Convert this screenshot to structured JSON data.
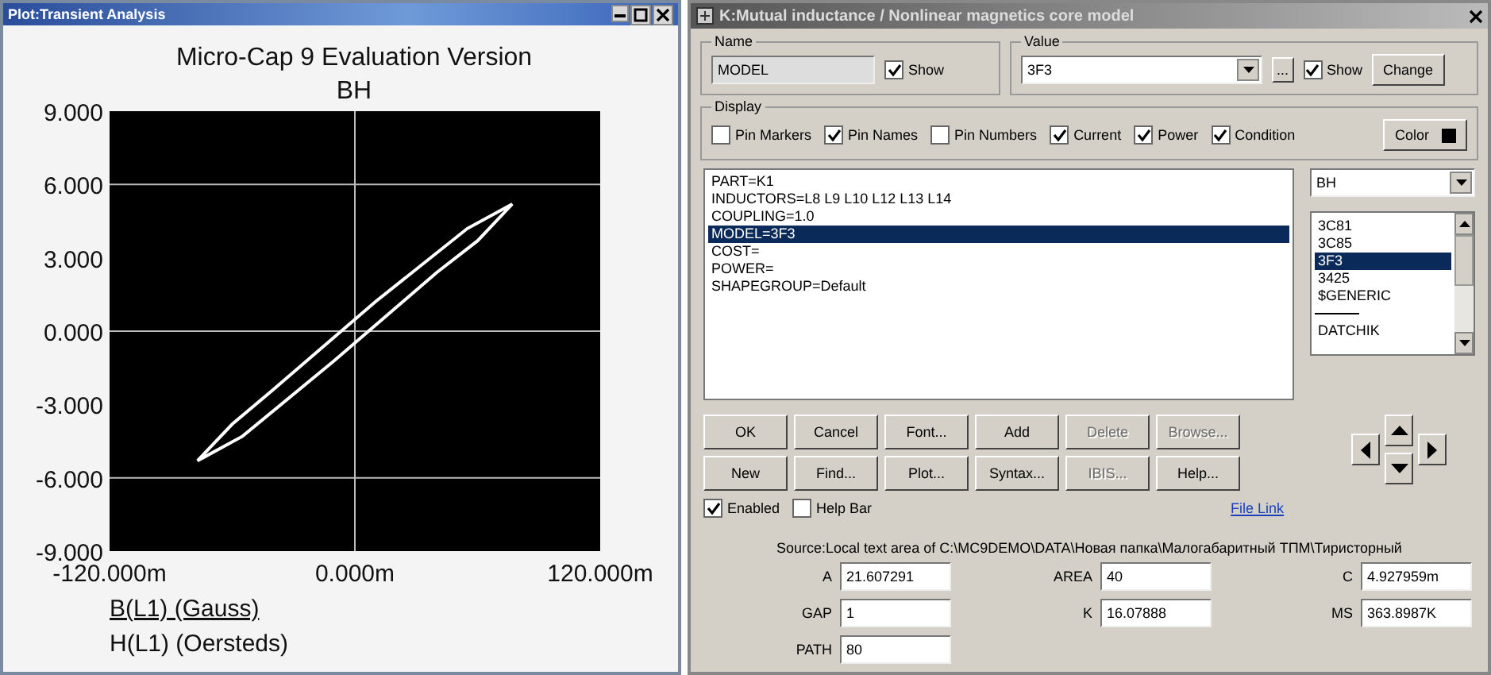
{
  "plot_window": {
    "title": "Plot:Transient Analysis",
    "heading": "Micro-Cap 9 Evaluation Version",
    "curve_label": "B(L1) (Gauss)",
    "chart_data": {
      "type": "line",
      "title": "BH",
      "xlabel": "H(L1) (Oersteds)",
      "grid": true,
      "xlim": [
        -120,
        120
      ],
      "ylim": [
        -9,
        9
      ],
      "xticks": [
        {
          "value": -120,
          "label": "-120.000m"
        },
        {
          "value": 0,
          "label": "0.000m"
        },
        {
          "value": 120,
          "label": "120.000m"
        }
      ],
      "yticks": [
        {
          "value": 9,
          "label": "9.000"
        },
        {
          "value": 6,
          "label": "6.000"
        },
        {
          "value": 3,
          "label": "3.000"
        },
        {
          "value": 0,
          "label": "0.000"
        },
        {
          "value": -3,
          "label": "-3.000"
        },
        {
          "value": -6,
          "label": "-6.000"
        },
        {
          "value": -9,
          "label": "-9.000"
        }
      ]
    }
  },
  "dialog": {
    "title": "K:Mutual inductance / Nonlinear magnetics core model",
    "name_group": {
      "label": "Name",
      "value": "MODEL",
      "show_label": "Show",
      "show_checked": true
    },
    "value_group": {
      "label": "Value",
      "value": "3F3",
      "more_button": "...",
      "show_label": "Show",
      "show_checked": true,
      "change_button": "Change"
    },
    "display_group": {
      "label": "Display",
      "options": [
        {
          "label": "Pin Markers",
          "checked": false
        },
        {
          "label": "Pin Names",
          "checked": true
        },
        {
          "label": "Pin Numbers",
          "checked": false
        },
        {
          "label": "Current",
          "checked": true
        },
        {
          "label": "Power",
          "checked": true
        },
        {
          "label": "Condition",
          "checked": true
        }
      ],
      "color_button": "Color"
    },
    "attributes": [
      {
        "text": "PART=K1",
        "selected": false
      },
      {
        "text": "INDUCTORS=L8 L9 L10 L12 L13 L14",
        "selected": false
      },
      {
        "text": "COUPLING=1.0",
        "selected": false
      },
      {
        "text": "MODEL=3F3",
        "selected": true
      },
      {
        "text": "COST=",
        "selected": false
      },
      {
        "text": "POWER=",
        "selected": false
      },
      {
        "text": "SHAPEGROUP=Default",
        "selected": false
      }
    ],
    "model_combo": "BH",
    "models": [
      {
        "text": "3C81",
        "selected": false,
        "kind": "item"
      },
      {
        "text": "3C85",
        "selected": false,
        "kind": "item"
      },
      {
        "text": "3F3",
        "selected": true,
        "kind": "item"
      },
      {
        "text": "3425",
        "selected": false,
        "kind": "item"
      },
      {
        "text": "$GENERIC",
        "selected": false,
        "kind": "item"
      },
      {
        "kind": "separator",
        "selected": false
      },
      {
        "text": "DATCHIK",
        "selected": false,
        "kind": "item"
      }
    ],
    "button_rows": [
      [
        {
          "label": "OK",
          "disabled": false
        },
        {
          "label": "Cancel",
          "disabled": false
        },
        {
          "label": "Font...",
          "disabled": false
        },
        {
          "label": "Add",
          "disabled": false
        },
        {
          "label": "Delete",
          "disabled": true
        },
        {
          "label": "Browse...",
          "disabled": true
        }
      ],
      [
        {
          "label": "New",
          "disabled": false
        },
        {
          "label": "Find...",
          "disabled": false
        },
        {
          "label": "Plot...",
          "disabled": false
        },
        {
          "label": "Syntax...",
          "disabled": false
        },
        {
          "label": "IBIS...",
          "disabled": true
        },
        {
          "label": "Help...",
          "disabled": false
        }
      ]
    ],
    "options": [
      {
        "label": "Enabled",
        "checked": true
      },
      {
        "label": "Help Bar",
        "checked": false
      }
    ],
    "file_link": "File Link",
    "source": "Source:Local text area of C:\\MC9DEMO\\DATA\\Новая папка\\Малогабаритный ТПМ\\Тиристорный",
    "params": [
      {
        "name": "A",
        "value": "21.607291"
      },
      {
        "name": "AREA",
        "value": "40"
      },
      {
        "name": "C",
        "value": "4.927959m"
      },
      {
        "name": "GAP",
        "value": "1"
      },
      {
        "name": "K",
        "value": "16.07888"
      },
      {
        "name": "MS",
        "value": "363.8987K"
      },
      {
        "name": "PATH",
        "value": "80"
      }
    ]
  }
}
